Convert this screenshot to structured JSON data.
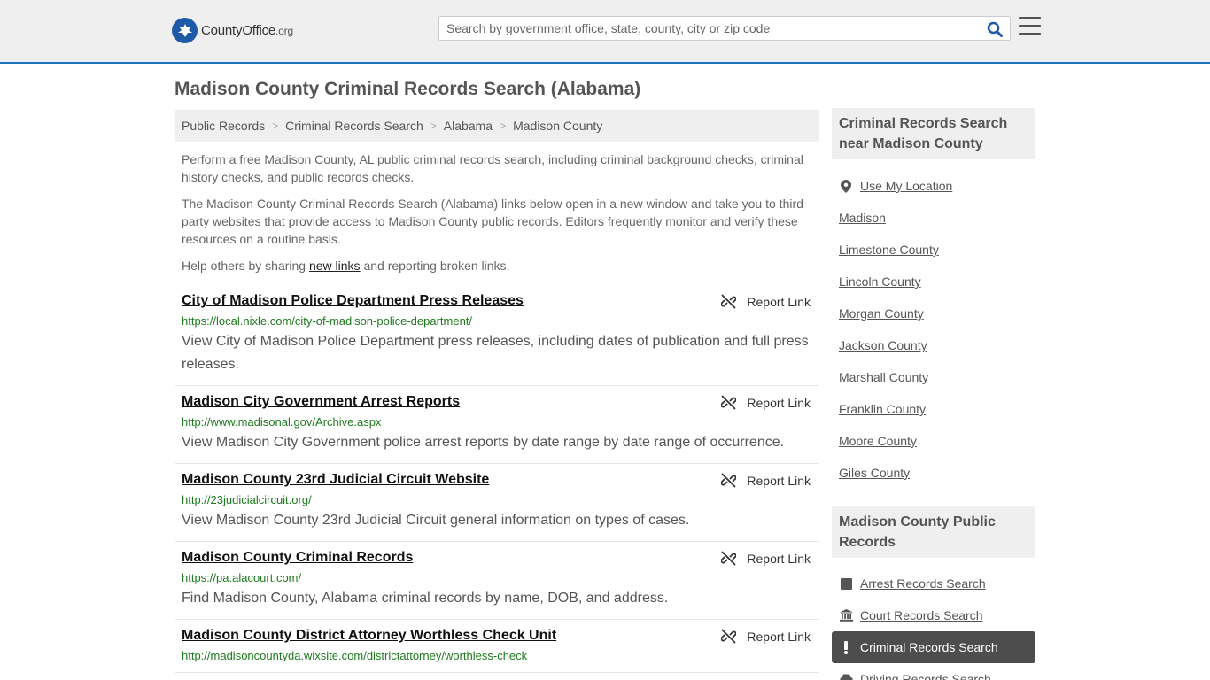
{
  "header": {
    "logo_main": "CountyOffice",
    "logo_suffix": ".org",
    "search_placeholder": "Search by government office, state, county, city or zip code"
  },
  "page": {
    "title": "Madison County Criminal Records Search (Alabama)"
  },
  "breadcrumb": [
    "Public Records",
    "Criminal Records Search",
    "Alabama",
    "Madison County"
  ],
  "intro": {
    "p1": "Perform a free Madison County, AL public criminal records search, including criminal background checks, criminal history checks, and public records checks.",
    "p2": "The Madison County Criminal Records Search (Alabama) links below open in a new window and take you to third party websites that provide access to Madison County public records. Editors frequently monitor and verify these resources on a routine basis.",
    "p3_before": "Help others by sharing ",
    "p3_link": "new links",
    "p3_after": " and reporting broken links."
  },
  "report_label": "Report Link",
  "results": [
    {
      "title": "City of Madison Police Department Press Releases",
      "url": "https://local.nixle.com/city-of-madison-police-department/",
      "desc": "View City of Madison Police Department press releases, including dates of publication and full press releases."
    },
    {
      "title": "Madison City Government Arrest Reports",
      "url": "http://www.madisonal.gov/Archive.aspx",
      "desc": "View Madison City Government police arrest reports by date range by date range of occurrence."
    },
    {
      "title": "Madison County 23rd Judicial Circuit Website",
      "url": "http://23judicialcircuit.org/",
      "desc": "View Madison County 23rd Judicial Circuit general information on types of cases."
    },
    {
      "title": "Madison County Criminal Records",
      "url": "https://pa.alacourt.com/",
      "desc": "Find Madison County, Alabama criminal records by name, DOB, and address."
    },
    {
      "title": "Madison County District Attorney Worthless Check Unit",
      "url": "http://madisoncountyda.wixsite.com/districtattorney/worthless-check",
      "desc": ""
    }
  ],
  "sidebar": {
    "nearby_title": "Criminal Records Search near Madison County",
    "use_location": "Use My Location",
    "nearby": [
      "Madison",
      "Limestone County",
      "Lincoln County",
      "Morgan County",
      "Jackson County",
      "Marshall County",
      "Franklin County",
      "Moore County",
      "Giles County"
    ],
    "public_title": "Madison County Public Records",
    "public": [
      {
        "label": "Arrest Records Search",
        "icon": "square-icon"
      },
      {
        "label": "Court Records Search",
        "icon": "courthouse-icon"
      },
      {
        "label": "Criminal Records Search",
        "icon": "exclamation-icon",
        "active": true
      },
      {
        "label": "Driving Records Search",
        "icon": "car-icon"
      }
    ]
  },
  "colors": {
    "accent": "#1e73be",
    "url_green": "#1e7a1e",
    "active_bg": "#4d4d4d"
  }
}
